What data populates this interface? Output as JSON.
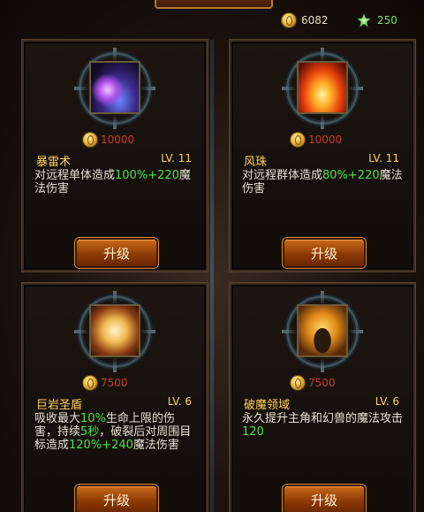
{
  "header": {
    "title": "",
    "gold": "6082",
    "green_currency": "250"
  },
  "icons": {
    "gold": "gold-coin-icon",
    "green": "green-gem-icon"
  },
  "colors": {
    "name_text": "#ffd35a",
    "highlight": "#4ee04a",
    "cost_text": "#c83a2a",
    "button": "#a04a0e"
  },
  "skills": [
    {
      "name": "暴雷术",
      "level": "LV. 11",
      "cost": "10000",
      "desc_pre": "对远程单体造成",
      "desc_hl": "100%+220",
      "desc_post": "魔法伤害",
      "button": "升级"
    },
    {
      "name": "风珠",
      "level": "LV. 11",
      "cost": "10000",
      "desc_pre": "对远程群体造成",
      "desc_hl": "80%+220",
      "desc_post": "魔法伤害",
      "button": "升级"
    },
    {
      "name": "巨岩圣盾",
      "level": "LV. 6",
      "cost": "7500",
      "desc_a": "吸收最大",
      "desc_b": "10%",
      "desc_c": "生命上限的伤害，持续",
      "desc_d": "5秒",
      "desc_e": "，破裂后对周围目标造成",
      "desc_f": "120%+240",
      "desc_g": "魔法伤害",
      "button": "升级"
    },
    {
      "name": "破魔领域",
      "level": "LV. 6",
      "cost": "7500",
      "desc_pre": "永久提升主角和幻兽的魔法攻击",
      "desc_hl": "120",
      "desc_post": "",
      "button": "升级"
    }
  ]
}
